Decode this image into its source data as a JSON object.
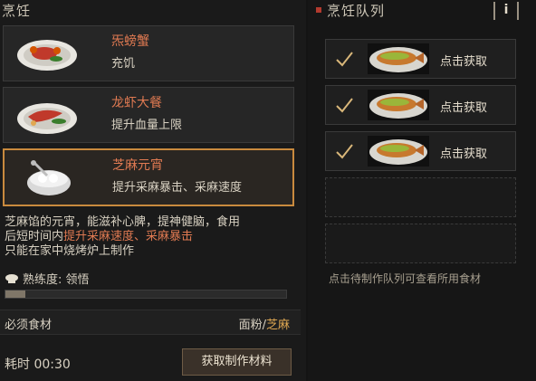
{
  "left_panel": {
    "title": "烹饪",
    "recipes": [
      {
        "name": "炁螃蟹",
        "desc": "充饥",
        "icon": "crab-dish-icon"
      },
      {
        "name": "龙虾大餐",
        "desc": "提升血量上限",
        "icon": "lobster-dish-icon"
      },
      {
        "name": "芝麻元宵",
        "desc": "提升采麻暴击、采麻速度",
        "icon": "sesame-dumpling-icon"
      }
    ],
    "description": {
      "line1": "芝麻馅的元宵，能滋补心脾，提神健脑，食用",
      "line2_prefix": "后短时间内",
      "line2_highlight": "提升采麻速度、采麻暴击",
      "line3": "只能在家中烧烤炉上制作"
    },
    "proficiency": {
      "label": "熟练度: 领悟",
      "progress": 0.07
    },
    "ingredients": {
      "label": "必须食材",
      "item1": "面粉",
      "sep": "/",
      "item2": "芝麻"
    },
    "time": "耗时 00:30",
    "get_materials_button": "获取制作材料"
  },
  "right_panel": {
    "title": "烹饪队列",
    "info_label": "i",
    "slots": [
      {
        "status": "done",
        "action": "点击获取",
        "icon": "grilled-fish-icon"
      },
      {
        "status": "done",
        "action": "点击获取",
        "icon": "grilled-fish-icon"
      },
      {
        "status": "done",
        "action": "点击获取",
        "icon": "grilled-fish-icon"
      }
    ],
    "hint": "点击待制作队列可查看所用食材"
  },
  "colors": {
    "accent": "#e07a52",
    "selected_border": "#c98a3e",
    "background": "#1a1a1a"
  }
}
